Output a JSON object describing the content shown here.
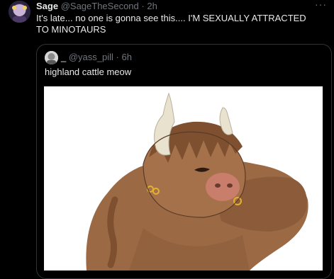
{
  "post": {
    "author_name": "Sage",
    "author_handle": "@SageTheSecond",
    "separator": "·",
    "time": "2h",
    "more_label": "···",
    "text": "It's late... no one is gonna see this.... I'M SEXUALLY ATTRACTED TO MINOTAURS"
  },
  "quoted_post": {
    "author_name": "_",
    "author_handle": "@yass_pill",
    "separator": "·",
    "time": "6h",
    "text": "highland cattle meow"
  },
  "colors": {
    "background": "#000000",
    "text_primary": "#e7e9ea",
    "text_secondary": "#71767b",
    "border": "#2f3336",
    "fur": "#9b6a45"
  },
  "icons": [
    "more-icon"
  ]
}
